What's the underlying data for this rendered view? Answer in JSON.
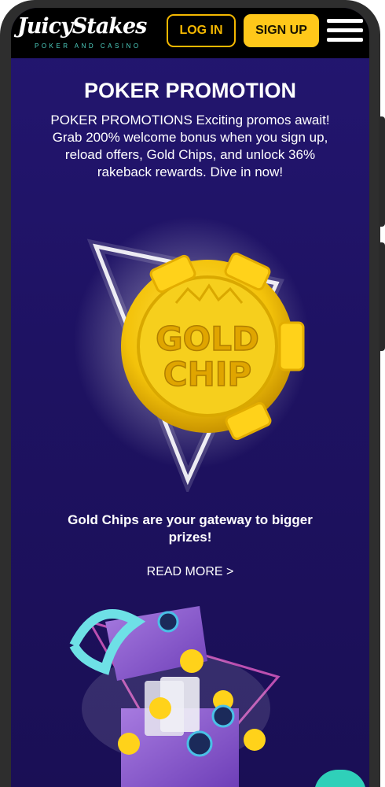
{
  "header": {
    "logo_text": "JuicyStakes",
    "logo_tagline": "POKER AND CASINO",
    "login_label": "LOG IN",
    "signup_label": "SIGN UP",
    "menu_icon": "hamburger-menu-icon"
  },
  "main": {
    "title": "POKER PROMOTION",
    "description": "POKER PROMOTIONS Exciting promos await! Grab 200% welcome bonus when you sign up, reload offers, Gold Chips, and unlock 36% rakeback rewards. Dive in now!",
    "chip_text_line1": "GOLD",
    "chip_text_line2": "CHIP",
    "promo_heading": "Gold Chips are your gateway to bigger prizes!",
    "read_more": "READ MORE >"
  },
  "colors": {
    "background": "#1e1262",
    "accent": "#ffc81a",
    "chat": "#2fd0b9"
  }
}
